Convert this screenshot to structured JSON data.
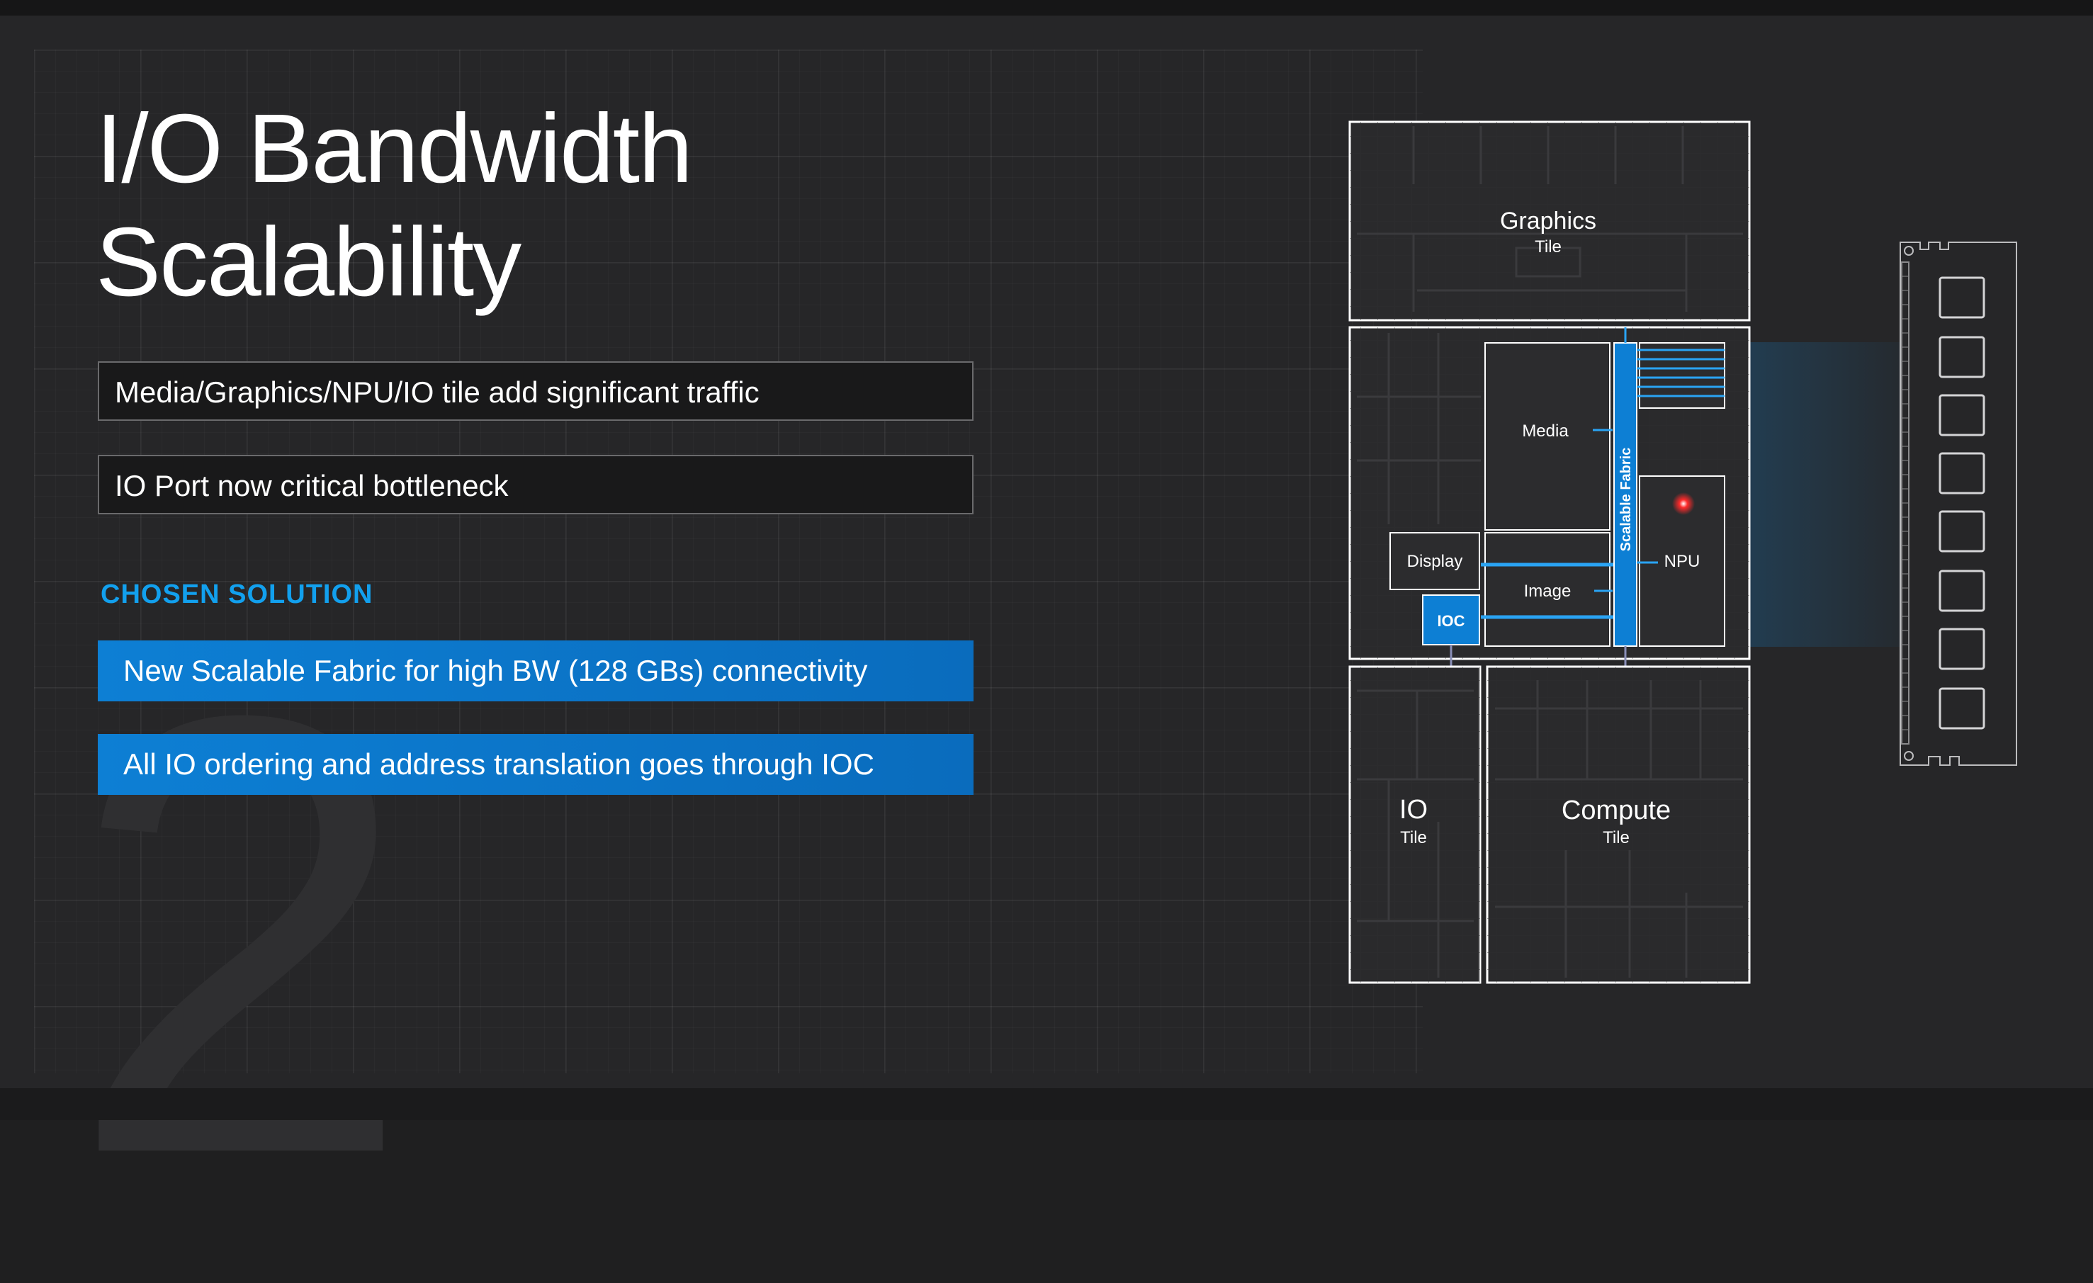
{
  "slide": {
    "title_line1": "I/O Bandwidth",
    "title_line2": "Scalability",
    "background_number": "2"
  },
  "problems": [
    "Media/Graphics/NPU/IO tile add significant traffic",
    "IO Port now critical bottleneck"
  ],
  "solution": {
    "heading": "CHOSEN SOLUTION",
    "items": [
      "New Scalable Fabric for high BW (128 GBs) connectivity",
      "All IO ordering and address translation goes through IOC"
    ]
  },
  "diagram": {
    "graphics_tile": {
      "name": "Graphics",
      "sub": "Tile"
    },
    "soc": {
      "media": "Media",
      "display": "Display",
      "image": "Image",
      "ioc": "IOC",
      "npu": "NPU",
      "fabric": "Scalable Fabric"
    },
    "io_tile": {
      "name": "IO",
      "sub": "Tile"
    },
    "compute_tile": {
      "name": "Compute",
      "sub": "Tile"
    },
    "memory_module": "memory-dimm-icon"
  },
  "colors": {
    "accent_blue": "#0d7fd4",
    "heading_blue": "#12a0ee",
    "line_blue": "#2aa4f4",
    "npu_dot": "#ff2a2a"
  }
}
